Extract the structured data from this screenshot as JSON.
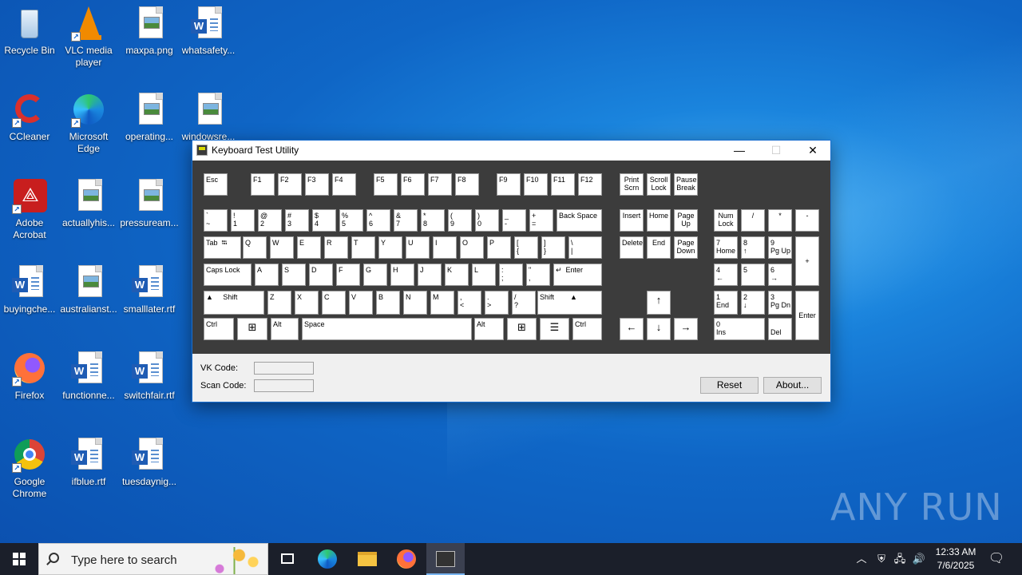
{
  "desktop": {
    "icons": [
      {
        "label": "Recycle Bin",
        "kind": "recycle"
      },
      {
        "label": "VLC media player",
        "kind": "vlc"
      },
      {
        "label": "maxpa.png",
        "kind": "image"
      },
      {
        "label": "whatsafety...",
        "kind": "word"
      },
      {
        "label": "CCleaner",
        "kind": "ccleaner"
      },
      {
        "label": "Microsoft Edge",
        "kind": "edge"
      },
      {
        "label": "operating...",
        "kind": "image"
      },
      {
        "label": "windowsre...",
        "kind": "image"
      },
      {
        "label": "Adobe Acrobat",
        "kind": "acrobat"
      },
      {
        "label": "actuallyhis...",
        "kind": "image"
      },
      {
        "label": "pressuream...",
        "kind": "image"
      },
      {
        "label": "buyingche...",
        "kind": "word"
      },
      {
        "label": "australianst...",
        "kind": "image"
      },
      {
        "label": "smalllater.rtf",
        "kind": "word"
      },
      {
        "label": "Firefox",
        "kind": "firefox"
      },
      {
        "label": "functionne...",
        "kind": "word"
      },
      {
        "label": "switchfair.rtf",
        "kind": "word"
      },
      {
        "label": "Google Chrome",
        "kind": "chrome"
      },
      {
        "label": "ifblue.rtf",
        "kind": "word"
      },
      {
        "label": "tuesdaynig...",
        "kind": "word"
      }
    ],
    "watermark": "ANY RUN"
  },
  "window": {
    "title": "Keyboard Test Utility",
    "minimize": "—",
    "maximize": "☐",
    "close": "✕",
    "keys": {
      "esc": "Esc",
      "f1": "F1",
      "f2": "F2",
      "f3": "F3",
      "f4": "F4",
      "f5": "F5",
      "f6": "F6",
      "f7": "F7",
      "f8": "F8",
      "f9": "F9",
      "f10": "F10",
      "f11": "F11",
      "f12": "F12",
      "prtsc": "Print\nScrn",
      "scroll": "Scroll\nLock",
      "pause": "Pause\nBreak",
      "tilde": "`\n~",
      "k1": "!\n1",
      "k2": "@\n2",
      "k3": "#\n3",
      "k4": "$\n4",
      "k5": "%\n5",
      "k6": "^\n6",
      "k7": "&\n7",
      "k8": "*\n8",
      "k9": "(\n9",
      "k0": ")\n0",
      "minus": "_\n-",
      "equal": "+\n=",
      "backspace": "Back Space",
      "tab": "Tab  ⭾",
      "q": "Q",
      "w": "W",
      "e": "E",
      "r": "R",
      "t": "T",
      "y": "Y",
      "u": "U",
      "i": "I",
      "o": "O",
      "p": "P",
      "lbracket": "[\n{",
      "rbracket": "]\n}",
      "backslash": "\\\n|",
      "caps": "Caps Lock",
      "a": "A",
      "s": "S",
      "d": "D",
      "f": "F",
      "g": "G",
      "h": "H",
      "j": "J",
      "k": "K",
      "l": "L",
      "semicolon": ":\n;",
      "quote": "\"\n,",
      "enter": "↵  Enter",
      "lshift": "▲     Shift",
      "z": "Z",
      "x": "X",
      "c": "C",
      "v": "V",
      "b": "B",
      "n": "N",
      "m": "M",
      "comma": ",\n<",
      "period": ".\n>",
      "slash": "/\n?",
      "rshift": "Shift        ▲",
      "lctrl": "Ctrl",
      "lwin": "⊞",
      "lalt": "Alt",
      "space": "Space",
      "ralt": "Alt",
      "rwin": "⊞",
      "menu": "☰",
      "rctrl": "Ctrl",
      "insert": "Insert",
      "home": "Home",
      "pgup": "Page\nUp",
      "delete": "Delete",
      "end": "End",
      "pgdn": "Page\nDown",
      "up": "↑",
      "left": "←",
      "down": "↓",
      "right": "→",
      "numlock": "Num\nLock",
      "ndiv": "/",
      "nmul": "*",
      "nsub": "-",
      "n7": "7\nHome",
      "n8": "8\n↑",
      "n9": "9\nPg Up",
      "nadd": "+",
      "n4": "4\n←",
      "n5": "5",
      "n6": "6\n→",
      "n1": "1\nEnd",
      "n2": "2\n↓",
      "n3": "3\nPg Dn",
      "nenter": "Enter",
      "n0": "0\nIns",
      "ndel": "\nDel"
    },
    "vk_label": "VK Code:",
    "vk_value": "",
    "scan_label": "Scan Code:",
    "scan_value": "",
    "reset_button": "Reset",
    "about_button": "About..."
  },
  "taskbar": {
    "search_placeholder": "Type here to search",
    "time": "12:33 AM",
    "date": "7/6/2025"
  }
}
